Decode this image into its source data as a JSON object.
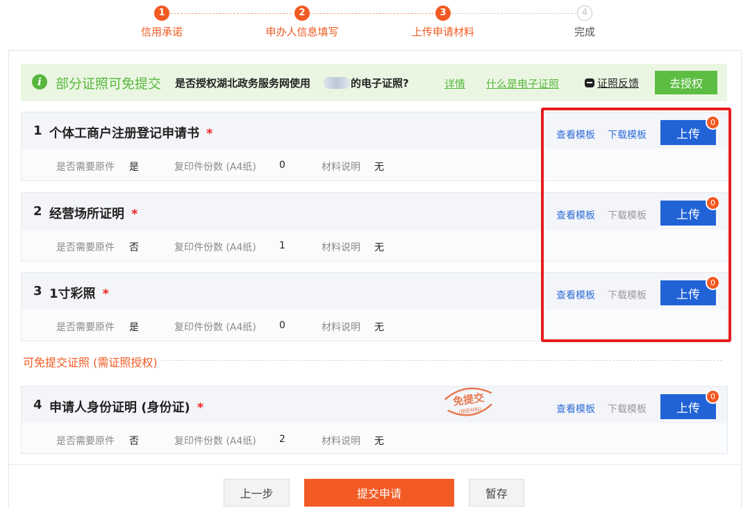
{
  "stepper": {
    "steps": [
      {
        "num": "1",
        "label": "信用承诺",
        "state": "done"
      },
      {
        "num": "2",
        "label": "申办人信息填写",
        "state": "done"
      },
      {
        "num": "3",
        "label": "上传申请材料",
        "state": "current"
      },
      {
        "num": "4",
        "label": "完成",
        "state": "todo"
      }
    ]
  },
  "auth_bar": {
    "headline": "部分证照可免提交",
    "question_prefix": "是否授权湖北政务服务网使用",
    "question_suffix": "的电子证照?",
    "details_link": "详情",
    "what_is_link": "什么是电子证照",
    "feedback_link": "证照反馈",
    "authorize_button": "去授权"
  },
  "materials": [
    {
      "index": "1",
      "title": "个体工商户注册登记申请书",
      "required_mark": "*",
      "original_label": "是否需要原件",
      "original_value": "是",
      "copies_label": "复印件份数 (A4纸)",
      "copies_value": "0",
      "desc_label": "材料说明",
      "desc_value": "无",
      "view_template": "查看模板",
      "download_template": "下载模板",
      "download_enabled": true,
      "upload": "上传",
      "upload_count": "0"
    },
    {
      "index": "2",
      "title": "经营场所证明",
      "required_mark": "*",
      "original_label": "是否需要原件",
      "original_value": "否",
      "copies_label": "复印件份数 (A4纸)",
      "copies_value": "1",
      "desc_label": "材料说明",
      "desc_value": "无",
      "view_template": "查看模板",
      "download_template": "下载模板",
      "download_enabled": false,
      "upload": "上传",
      "upload_count": "0"
    },
    {
      "index": "3",
      "title": "1寸彩照",
      "required_mark": "*",
      "original_label": "是否需要原件",
      "original_value": "是",
      "copies_label": "复印件份数 (A4纸)",
      "copies_value": "0",
      "desc_label": "材料说明",
      "desc_value": "无",
      "view_template": "查看模板",
      "download_template": "下载模板",
      "download_enabled": false,
      "upload": "上传",
      "upload_count": "0"
    },
    {
      "index": "4",
      "title": "申请人身份证明 (身份证)",
      "required_mark": "*",
      "original_label": "是否需要原件",
      "original_value": "否",
      "copies_label": "复印件份数 (A4纸)",
      "copies_value": "2",
      "desc_label": "材料说明",
      "desc_value": "无",
      "view_template": "查看模板",
      "download_template": "下载模板",
      "download_enabled": false,
      "upload": "上传",
      "upload_count": "0"
    }
  ],
  "exempt_section_label": "可免提交证照 (需证照授权)",
  "stamp": {
    "text": "免提交",
    "subtext": "(保密材料)"
  },
  "footer": {
    "prev_button": "上一步",
    "submit_button": "提交申请",
    "save_button": "暂存"
  },
  "colors": {
    "accent_orange": "#f15a22",
    "auth_green": "#57b73c",
    "upload_blue": "#2163d6",
    "highlight_red": "#e61c1c"
  }
}
